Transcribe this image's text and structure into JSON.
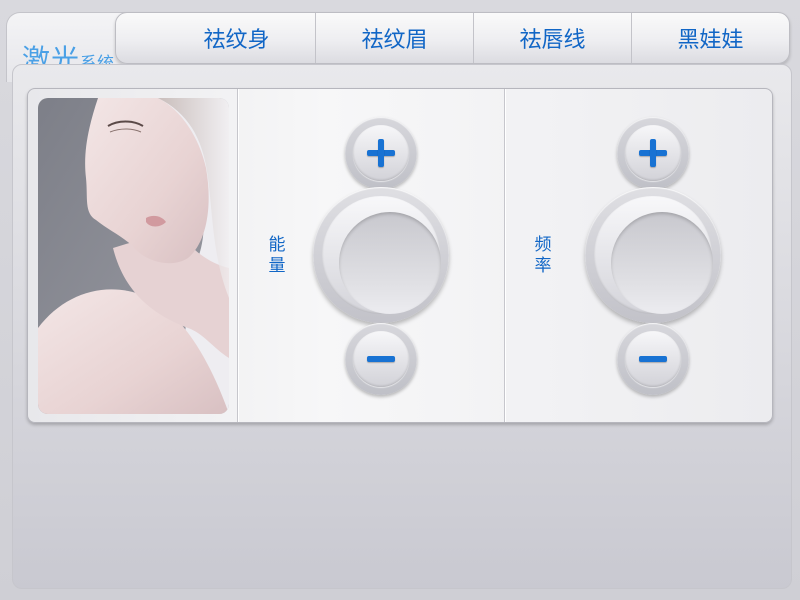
{
  "header": {
    "brand_big": "激光",
    "brand_small": "系统",
    "tabs": [
      {
        "label": "祛纹身"
      },
      {
        "label": "祛纹眉"
      },
      {
        "label": "祛唇线"
      },
      {
        "label": "黑娃娃"
      }
    ]
  },
  "controls": {
    "energy": {
      "label": "能量"
    },
    "frequency": {
      "label": "频率"
    }
  },
  "colors": {
    "accent": "#1166c6",
    "brand": "#4aa0e6",
    "background": "#d5d5db"
  },
  "icons": {
    "increase": "plus-icon",
    "decrease": "minus-icon"
  }
}
